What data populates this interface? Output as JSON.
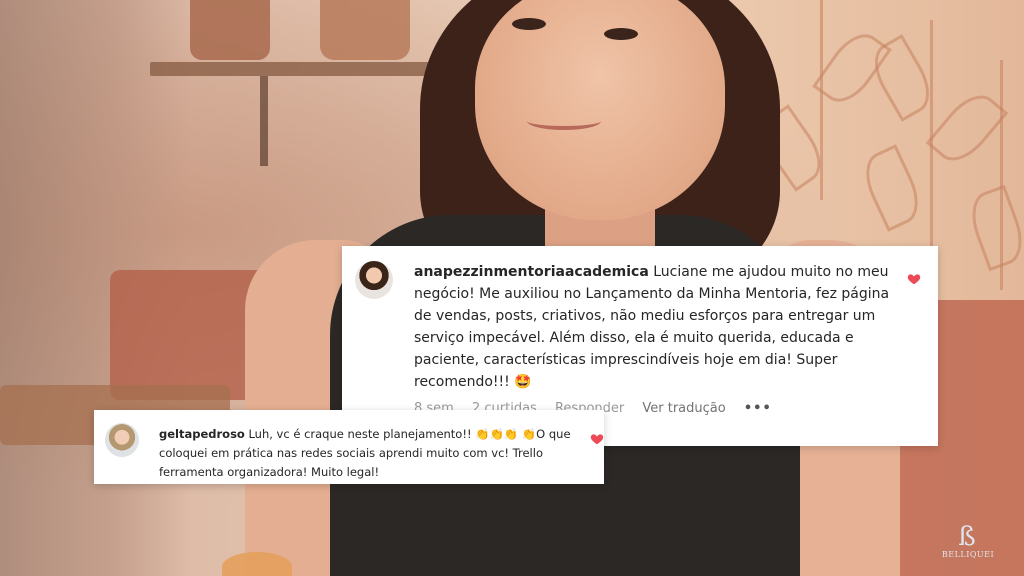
{
  "comments": [
    {
      "username": "anapezzinmentoriaacademica",
      "text": "Luciane me ajudou muito no meu negócio! Me auxiliou no Lançamento da Minha Mentoria, fez página de vendas, posts, criativos, não mediu esforços para entregar um serviço impecável. Além disso, ela é muito querida, educada e paciente, características imprescindíveis hoje em dia! Super recomendo!!! 🤩",
      "meta": {
        "time": "8 sem",
        "likes": "2 curtidas",
        "reply": "Responder",
        "translate": "Ver tradução",
        "more": "•••"
      },
      "heart_color": "#ed4956"
    },
    {
      "username": "geltapedroso",
      "text": "Luh, vc é craque neste planejamento!! 👏👏👏 👏O que coloquei em prática nas redes sociais aprendi muito com vc! Trello ferramenta organizadora! Muito legal!",
      "heart_color": "#ed4956"
    }
  ],
  "logo": {
    "mark": "ß",
    "text": "BELLIQUEI"
  }
}
